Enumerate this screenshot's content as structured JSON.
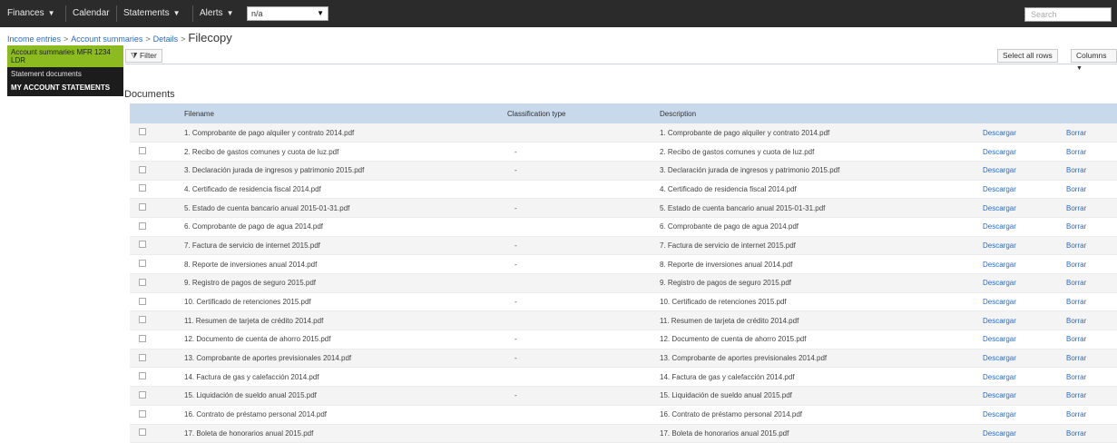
{
  "topbar": {
    "menus": [
      "Finances",
      "Calendar",
      "Statements",
      "Alerts"
    ],
    "select_value": "n/a",
    "search_placeholder": "Search"
  },
  "breadcrumb": {
    "items": [
      "Income entries",
      "Account summaries",
      "Details"
    ],
    "current": "Filecopy"
  },
  "sidebar": {
    "items": [
      "Account summaries MFR 1234 LDR",
      "Statement documents",
      "MY ACCOUNT STATEMENTS"
    ]
  },
  "toolbar": {
    "left_button": "Filter",
    "right_buttons": [
      "Select all rows",
      "Columns"
    ]
  },
  "section_title": "Documents",
  "table": {
    "headers": [
      "Filename",
      "Classification type",
      "Description",
      "",
      ""
    ],
    "rows": [
      {
        "name": "1. Comprobante de pago alquiler y contrato 2014.pdf",
        "class": "",
        "desc": "1. Comprobante de pago alquiler y contrato 2014.pdf",
        "a1": "Descargar",
        "a2": "Borrar"
      },
      {
        "name": "2. Recibo de gastos comunes y cuota de luz.pdf",
        "class": "-",
        "desc": "2. Recibo de gastos comunes y cuota de luz.pdf",
        "a1": "Descargar",
        "a2": "Borrar"
      },
      {
        "name": "3. Declaración jurada de ingresos y patrimonio 2015.pdf",
        "class": "-",
        "desc": "3. Declaración jurada de ingresos y patrimonio 2015.pdf",
        "a1": "Descargar",
        "a2": "Borrar"
      },
      {
        "name": "4. Certificado de residencia fiscal 2014.pdf",
        "class": "",
        "desc": "4. Certificado de residencia fiscal 2014.pdf",
        "a1": "Descargar",
        "a2": "Borrar"
      },
      {
        "name": "5. Estado de cuenta bancario anual 2015-01-31.pdf",
        "class": "-",
        "desc": "5. Estado de cuenta bancario anual 2015-01-31.pdf",
        "a1": "Descargar",
        "a2": "Borrar"
      },
      {
        "name": "6. Comprobante de pago de agua 2014.pdf",
        "class": "",
        "desc": "6. Comprobante de pago de agua 2014.pdf",
        "a1": "Descargar",
        "a2": "Borrar"
      },
      {
        "name": "7. Factura de servicio de internet 2015.pdf",
        "class": "-",
        "desc": "7. Factura de servicio de internet 2015.pdf",
        "a1": "Descargar",
        "a2": "Borrar"
      },
      {
        "name": "8. Reporte de inversiones anual 2014.pdf",
        "class": "-",
        "desc": "8. Reporte de inversiones anual 2014.pdf",
        "a1": "Descargar",
        "a2": "Borrar"
      },
      {
        "name": "9. Registro de pagos de seguro 2015.pdf",
        "class": "",
        "desc": "9. Registro de pagos de seguro 2015.pdf",
        "a1": "Descargar",
        "a2": "Borrar"
      },
      {
        "name": "10. Certificado de retenciones 2015.pdf",
        "class": "-",
        "desc": "10. Certificado de retenciones 2015.pdf",
        "a1": "Descargar",
        "a2": "Borrar"
      },
      {
        "name": "11. Resumen de tarjeta de crédito 2014.pdf",
        "class": "",
        "desc": "11. Resumen de tarjeta de crédito 2014.pdf",
        "a1": "Descargar",
        "a2": "Borrar"
      },
      {
        "name": "12. Documento de cuenta de ahorro 2015.pdf",
        "class": "-",
        "desc": "12. Documento de cuenta de ahorro 2015.pdf",
        "a1": "Descargar",
        "a2": "Borrar"
      },
      {
        "name": "13. Comprobante de aportes previsionales 2014.pdf",
        "class": "-",
        "desc": "13. Comprobante de aportes previsionales 2014.pdf",
        "a1": "Descargar",
        "a2": "Borrar"
      },
      {
        "name": "14. Factura de gas y calefacción 2014.pdf",
        "class": "",
        "desc": "14. Factura de gas y calefacción 2014.pdf",
        "a1": "Descargar",
        "a2": "Borrar"
      },
      {
        "name": "15. Liquidación de sueldo anual 2015.pdf",
        "class": "-",
        "desc": "15. Liquidación de sueldo anual 2015.pdf",
        "a1": "Descargar",
        "a2": "Borrar"
      },
      {
        "name": "16. Contrato de préstamo personal 2014.pdf",
        "class": "",
        "desc": "16. Contrato de préstamo personal 2014.pdf",
        "a1": "Descargar",
        "a2": "Borrar"
      },
      {
        "name": "17. Boleta de honorarios anual 2015.pdf",
        "class": "",
        "desc": "17. Boleta de honorarios anual 2015.pdf",
        "a1": "Descargar",
        "a2": "Borrar"
      }
    ]
  }
}
